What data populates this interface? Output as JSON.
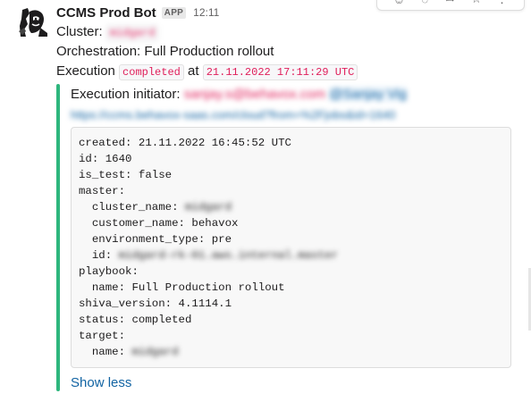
{
  "message": {
    "bot_name": "CCMS Prod Bot",
    "app_badge": "APP",
    "time": "12:11",
    "cluster_label": "Cluster:",
    "cluster_value": "midgard",
    "orchestration_text": "Orchestration: Full Production rollout",
    "execution_label": "Execution",
    "execution_status": "completed",
    "at_word": "at",
    "execution_time": "21.11.2022 17:11:29 UTC"
  },
  "attachment": {
    "accent_color": "#2eb67d",
    "initiator_label": "Execution initiator:",
    "initiator_email": "sanjay.s@behavox.com",
    "initiator_handle": "@Sanjay Vig",
    "url": "https://ccms.behavox-saas.com/cloud?from=%2Fjobs&id=1640",
    "code_lines": [
      "created: 21.11.2022 16:45:52 UTC",
      "id: 1640",
      "is_test: false",
      "master:",
      "  cluster_name: midgard",
      "  customer_name: behavox",
      "  environment_type: pre",
      "  id: midgard-rk-01.aws.internal.master",
      "playbook:",
      "  name: Full Production rollout",
      "shiva_version: 4.1114.1",
      "status: completed",
      "target:",
      "  name: midgard"
    ],
    "show_less": "Show less"
  },
  "toolbar": {
    "icons": [
      "emoji-reaction-icon",
      "reply-in-thread-icon",
      "share-icon",
      "bookmark-icon",
      "more-actions-icon"
    ]
  }
}
